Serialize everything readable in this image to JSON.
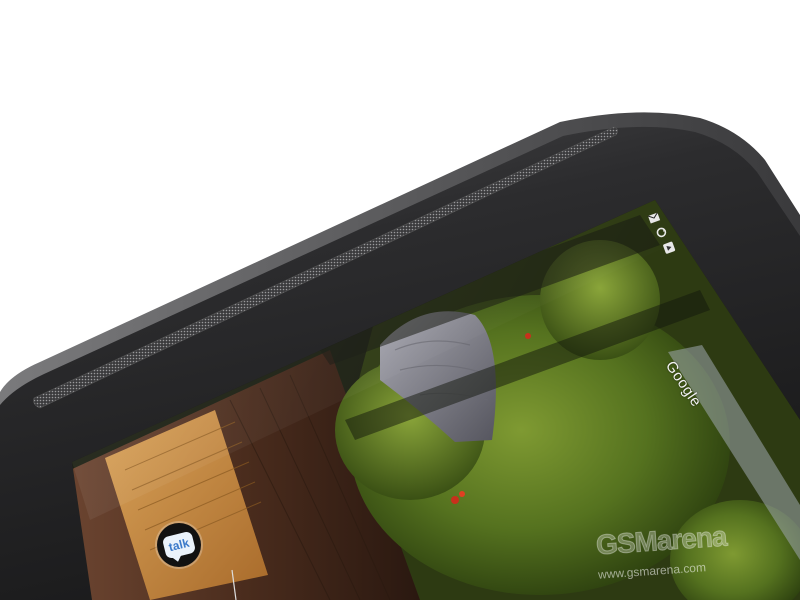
{
  "scene": {
    "subject": "Tablet top corner with front speaker grille and Android home screen",
    "colors": {
      "background": "#ffffff",
      "bezel": "#2a2a2b",
      "bezel_edge": "#6c6c6e",
      "moss": "#4f6b1e",
      "wood": "#5b3a25",
      "window_glow": "#c98a3e"
    }
  },
  "status_bar": {
    "icons": [
      "gmail-icon",
      "sync-icon",
      "play-store-icon"
    ]
  },
  "home_screen": {
    "search_widget_label": "Google",
    "app_icons": [
      {
        "name": "talk-app-icon",
        "label": "talk"
      }
    ]
  },
  "watermark": {
    "logo": "GSMarena",
    "url": "www.gsmarena.com"
  }
}
